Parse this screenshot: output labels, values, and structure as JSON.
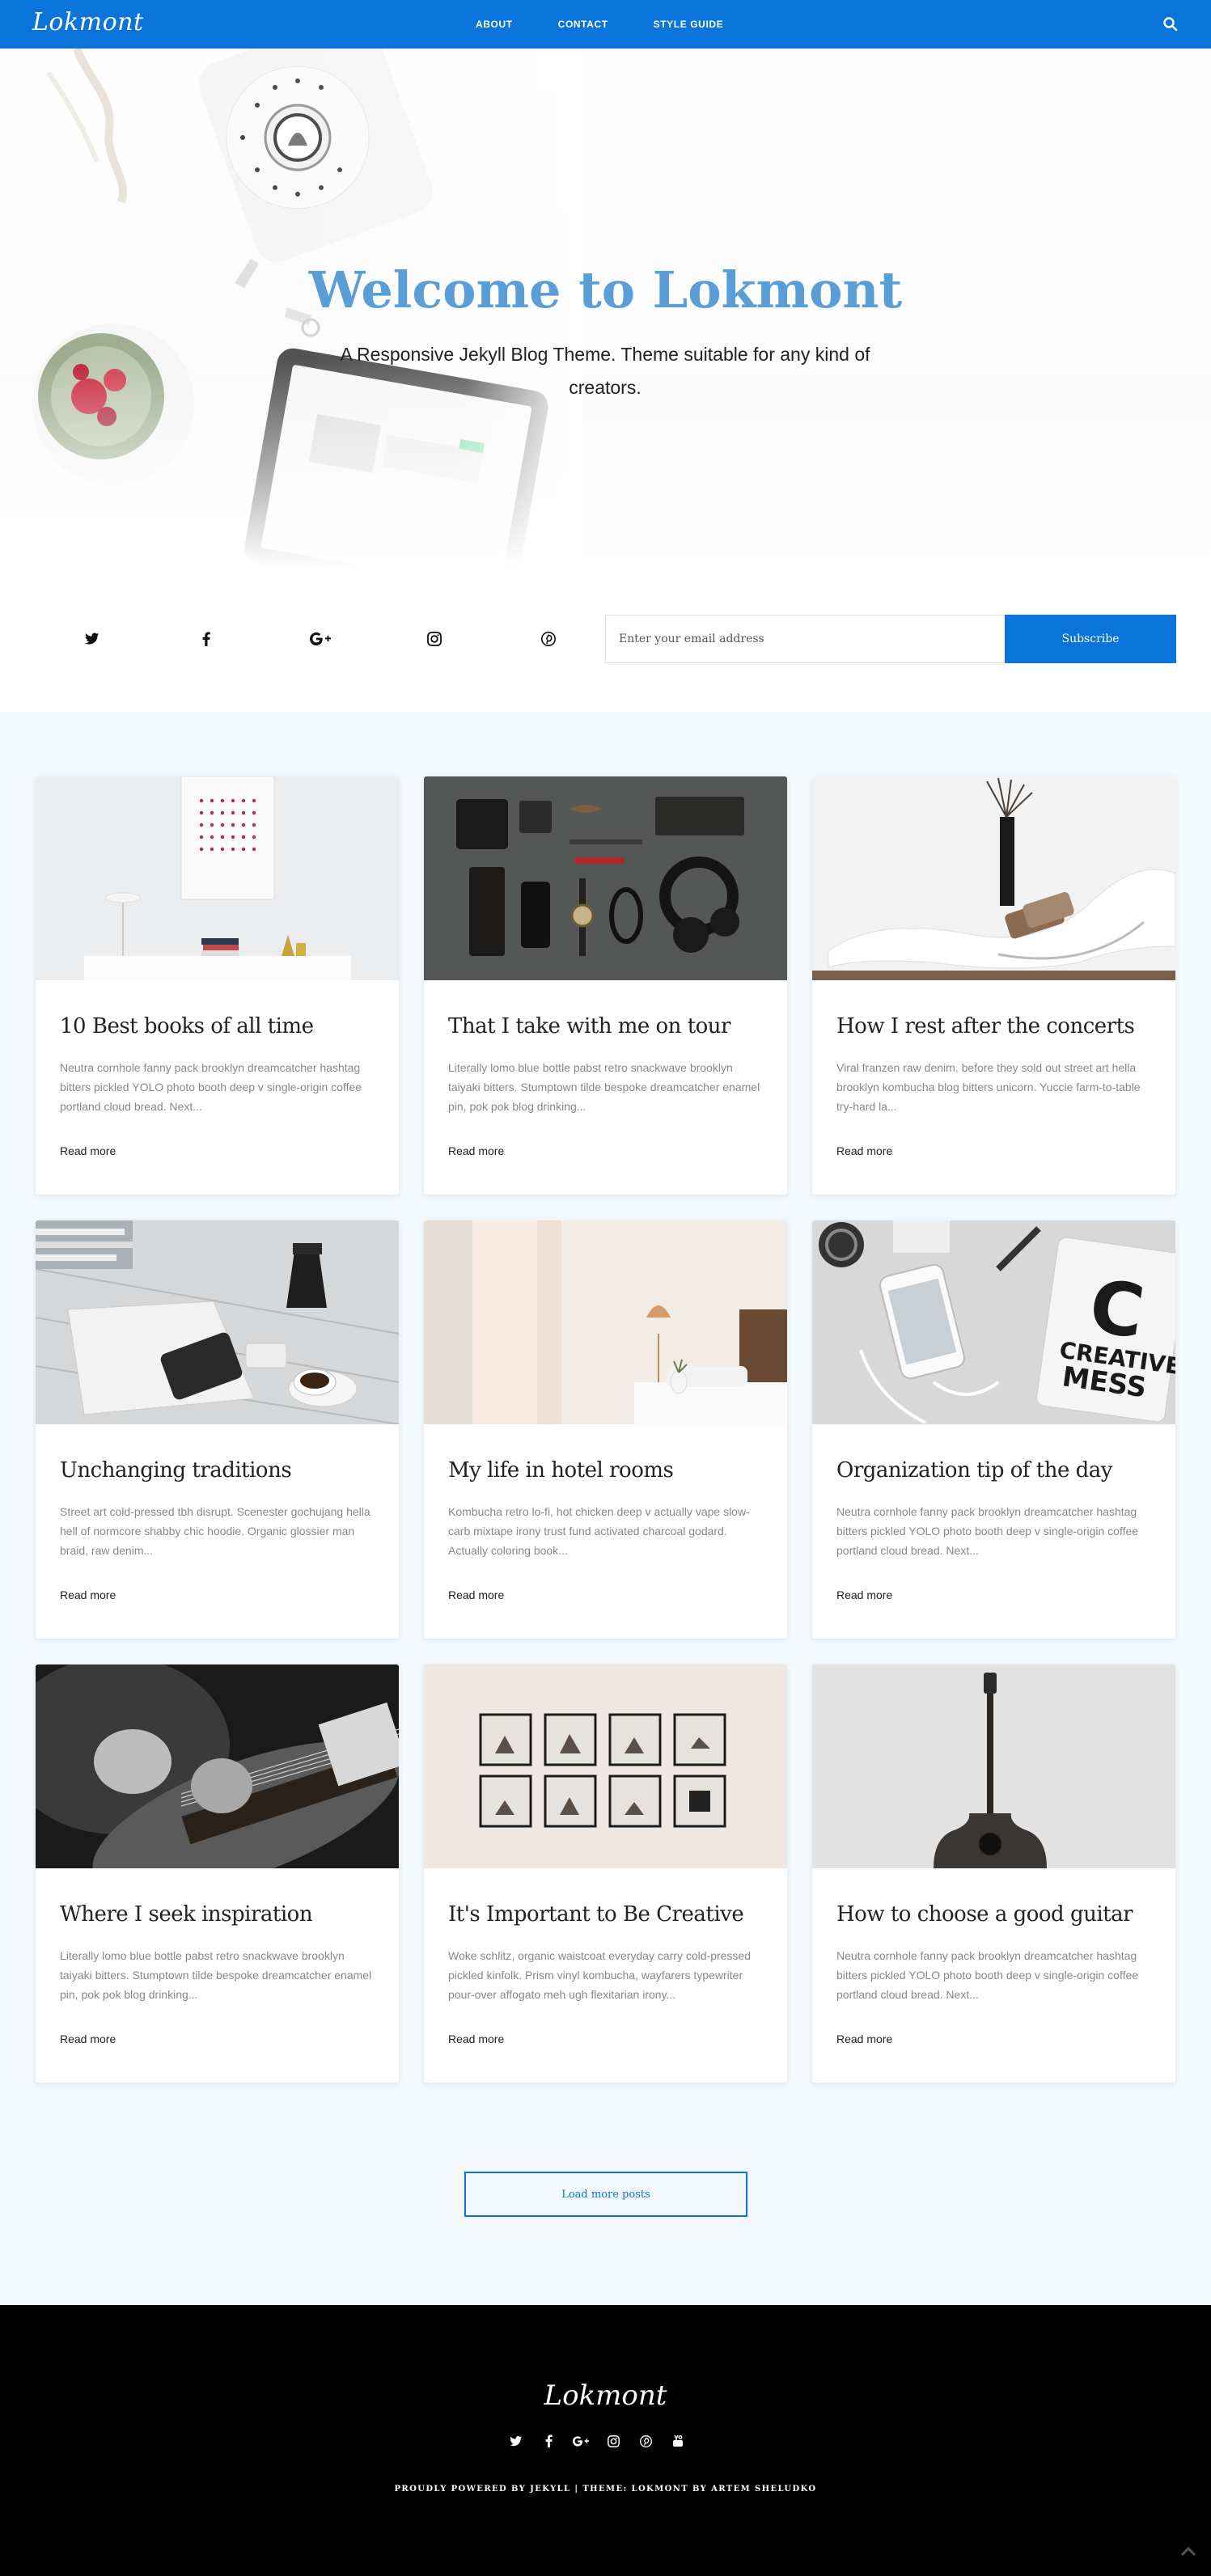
{
  "nav": {
    "logo": "Lokmont",
    "links": [
      "ABOUT",
      "CONTACT",
      "STYLE GUIDE"
    ],
    "search_icon": "search-icon"
  },
  "hero": {
    "title": "Welcome to Lokmont",
    "subtitle": "A Responsive Jekyll Blog Theme. Theme suitable for any kind of creators."
  },
  "social": {
    "icons": [
      "twitter-icon",
      "facebook-icon",
      "google-plus-icon",
      "instagram-icon",
      "pinterest-icon"
    ],
    "email_placeholder": "Enter your email address",
    "subscribe_label": "Subscribe"
  },
  "posts": [
    {
      "title": "10 Best books of all time",
      "excerpt": "Neutra cornhole fanny pack brooklyn dreamcatcher hashtag bitters pickled YOLO photo booth deep v single-origin coffee portland cloud bread. Next...",
      "read_more": "Read more"
    },
    {
      "title": "That I take with me on tour",
      "excerpt": "Literally lomo blue bottle pabst retro snackwave brooklyn taiyaki bitters. Stumptown tilde bespoke dreamcatcher enamel pin, pok pok blog drinking...",
      "read_more": "Read more"
    },
    {
      "title": "How I rest after the concerts",
      "excerpt": "Viral franzen raw denim, before they sold out street art hella brooklyn kombucha blog bitters unicorn. Yuccie farm-to-table try-hard la...",
      "read_more": "Read more"
    },
    {
      "title": "Unchanging traditions",
      "excerpt": "Street art cold-pressed tbh disrupt. Scenester gochujang hella hell of normcore shabby chic hoodie. Organic glossier man braid, raw denim...",
      "read_more": "Read more"
    },
    {
      "title": "My life in hotel rooms",
      "excerpt": "Kombucha retro lo-fi, hot chicken deep v actually vape slow-carb mixtape irony trust fund activated charcoal godard. Actually coloring book...",
      "read_more": "Read more"
    },
    {
      "title": "Organization tip of the day",
      "excerpt": "Neutra cornhole fanny pack brooklyn dreamcatcher hashtag bitters pickled YOLO photo booth deep v single-origin coffee portland cloud bread. Next...",
      "read_more": "Read more"
    },
    {
      "title": "Where I seek inspiration",
      "excerpt": "Literally lomo blue bottle pabst retro snackwave brooklyn taiyaki bitters. Stumptown tilde bespoke dreamcatcher enamel pin, pok pok blog drinking...",
      "read_more": "Read more"
    },
    {
      "title": "It's Important to Be Creative",
      "excerpt": "Woke schlitz, organic waistcoat everyday carry cold-pressed pickled kinfolk. Prism vinyl kombucha, wayfarers typewriter pour-over affogato meh ugh flexitarian irony...",
      "read_more": "Read more"
    },
    {
      "title": "How to choose a good guitar",
      "excerpt": "Neutra cornhole fanny pack brooklyn dreamcatcher hashtag bitters pickled YOLO photo booth deep v single-origin coffee portland cloud bread. Next...",
      "read_more": "Read more"
    }
  ],
  "image_sign": {
    "letter": "C",
    "line1": "CREATIVE",
    "line2": "MESS"
  },
  "load_more_label": "Load more posts",
  "footer": {
    "logo": "Lokmont",
    "icons": [
      "twitter-icon",
      "facebook-icon",
      "google-plus-icon",
      "instagram-icon",
      "pinterest-icon",
      "youtube-icon"
    ],
    "credit_prefix": "Proudly powered by",
    "credit_jekyll": "Jekyll",
    "credit_sep": "|",
    "credit_theme_prefix": "Theme:",
    "credit_theme": "Lokmont by Artem Sheludko",
    "back_to_top_icon": "chevron-up-icon"
  },
  "colors": {
    "brand": "#0a74da",
    "hero_title": "#5a9ed8",
    "posts_bg": "#f2f8fc",
    "footer_bg": "#000000"
  }
}
